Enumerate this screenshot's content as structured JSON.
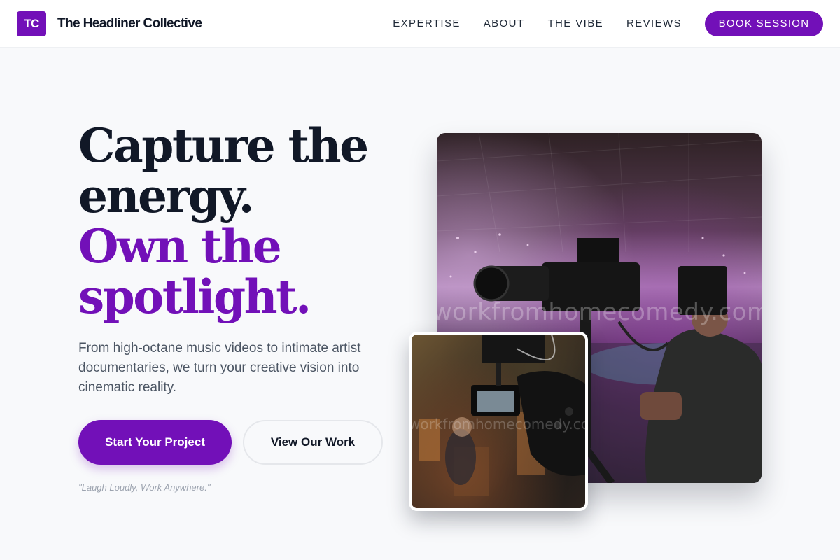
{
  "brand": {
    "logo_initials": "TC",
    "name": "The Headliner Collective"
  },
  "nav": {
    "links": [
      "EXPERTISE",
      "ABOUT",
      "THE VIBE",
      "REVIEWS"
    ],
    "cta_label": "BOOK SESSION"
  },
  "hero": {
    "headline_line1": "Capture the energy.",
    "headline_line2": "Own the spotlight.",
    "subtext": "From high-octane music videos to intimate artist documentaries, we turn your creative vision into cinematic reality.",
    "primary_cta": "Start Your Project",
    "secondary_cta": "View Our Work",
    "tagline": "\"Laugh Loudly, Work Anywhere.\""
  },
  "images": {
    "main_watermark": "workfromhomecomedy.com",
    "inset_watermark": "workfromhomecomedy.com"
  },
  "colors": {
    "accent": "#7210b8",
    "heading": "#111827",
    "body_text": "#4b5563",
    "background": "#f8f9fb"
  }
}
